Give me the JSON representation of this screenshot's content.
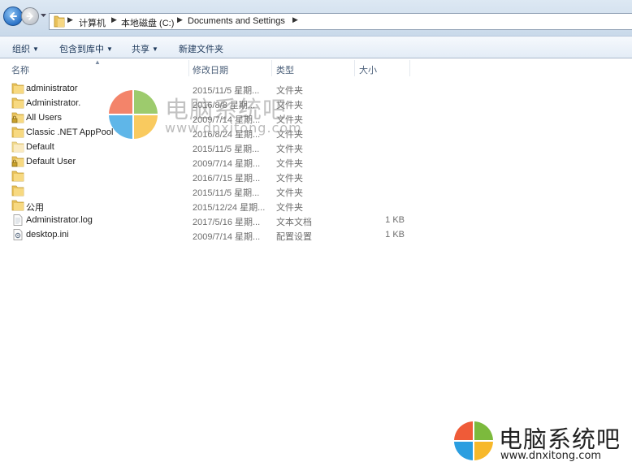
{
  "breadcrumbs": [
    "计算机",
    "本地磁盘 (C:)",
    "Documents and Settings"
  ],
  "toolbar": {
    "organize": "组织",
    "include_in_library": "包含到库中",
    "share": "共享",
    "new_folder": "新建文件夹"
  },
  "columns": {
    "name": "名称",
    "modified": "修改日期",
    "type": "类型",
    "size": "大小"
  },
  "files": [
    {
      "name": "administrator",
      "date": "2015/11/5 星期...",
      "type": "文件夹",
      "size": "",
      "icon": "folder-icon"
    },
    {
      "name": "Administrator.",
      "date": "2016/8/8 星期...",
      "type": "文件夹",
      "size": "",
      "icon": "folder-icon"
    },
    {
      "name": "All Users",
      "date": "2009/7/14 星期...",
      "type": "文件夹",
      "size": "",
      "icon": "folder-lock-icon"
    },
    {
      "name": "Classic .NET AppPool",
      "date": "2016/8/24 星期...",
      "type": "文件夹",
      "size": "",
      "icon": "folder-icon"
    },
    {
      "name": "Default",
      "date": "2015/11/5 星期...",
      "type": "文件夹",
      "size": "",
      "icon": "folder-icon"
    },
    {
      "name": "Default User",
      "date": "2009/7/14 星期...",
      "type": "文件夹",
      "size": "",
      "icon": "folder-lock-icon"
    },
    {
      "name": "",
      "date": "2016/7/15 星期...",
      "type": "文件夹",
      "size": "",
      "icon": "folder-icon"
    },
    {
      "name": "",
      "date": "2015/11/5 星期...",
      "type": "文件夹",
      "size": "",
      "icon": "folder-icon"
    },
    {
      "name": "公用",
      "date": "2015/12/24 星期...",
      "type": "文件夹",
      "size": "",
      "icon": "folder-icon"
    },
    {
      "name": "Administrator.log",
      "date": "2017/5/16 星期...",
      "type": "文本文档",
      "size": "1 KB",
      "icon": "text-file-icon"
    },
    {
      "name": "desktop.ini",
      "date": "2009/7/14 星期...",
      "type": "配置设置",
      "size": "1 KB",
      "icon": "settings-file-icon"
    }
  ],
  "watermark": {
    "title": "电脑系统吧",
    "url": "www.dnxitong.com"
  },
  "colors": {
    "folder": "#e8c15a",
    "logo_red": "#ef5b38",
    "logo_green": "#7cba3d",
    "logo_blue": "#2a9ee0",
    "logo_yellow": "#f7b82a"
  }
}
